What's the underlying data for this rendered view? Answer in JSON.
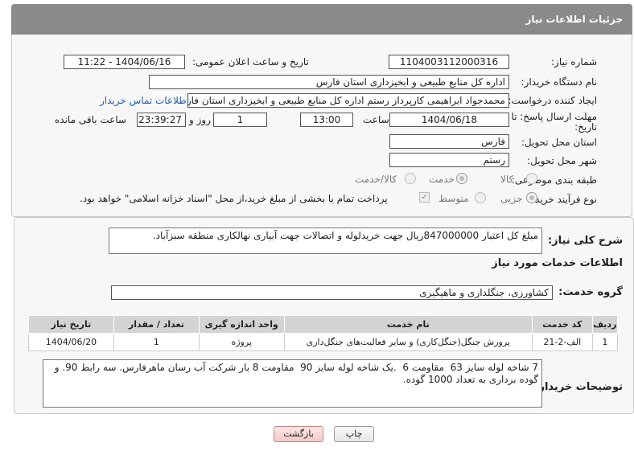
{
  "header": {
    "title": "جزئیات اطلاعات نیاز"
  },
  "fields": {
    "need_number_label": "شماره نیاز:",
    "need_number": "1104003112000316",
    "announce_label": "تاریخ و ساعت اعلان عمومی:",
    "announce_value": "1404/06/16 - 11:22",
    "buyer_org_label": "نام دستگاه خریدار:",
    "buyer_org": "اداره کل منابع طبیعی و ابخیزداری استان فارس",
    "requester_label": "ایجاد کننده درخواست:",
    "requester": "محمدجواد ابراهیمی کارپرداز رستم اداره کل منابع طبیعی و ابخیزداری استان فارس",
    "contact_link": "اطلاعات تماس خریدار",
    "deadline_label_1": "مهلت ارسال پاسخ: تا",
    "deadline_label_2": "تاریخ:",
    "deadline_date": "1404/06/18",
    "time_label": "ساعت",
    "deadline_time": "13:00",
    "days_value": "1",
    "days_label": "روز و",
    "remaining_time": "23:39:27",
    "remaining_label": "ساعت باقی مانده",
    "province_label": "استان محل تحویل:",
    "province": "فارس",
    "city_label": "شهر محل تحویل:",
    "city": "رستم",
    "category_label": "طبقه بندی موضوعی:",
    "category_options": [
      "کالا",
      "خدمت",
      "کالا/خدمت"
    ],
    "process_label": "نوع فرآیند خرید :",
    "process_options": [
      "جزیی",
      "متوسط"
    ],
    "payment_note": "پرداخت تمام یا بخشی از مبلغ خرید،از محل \"اسناد خزانه اسلامی\" خواهد بود."
  },
  "summary": {
    "label": "شرح کلی نیاز:",
    "text": "مبلغ کل اعتبار 847000000ریال جهت خریدلوله و اتصالات جهت آبیاری نهالکاری منطقه سبزآباد."
  },
  "services": {
    "section_title": "اطلاعات خدمات مورد نیاز",
    "group_label": "گروه خدمت:",
    "group_value": "کشاورزی، جنگلداری و ماهیگیری",
    "columns": [
      "ردیف",
      "کد خدمت",
      "نام خدمت",
      "واحد اندازه گیری",
      "تعداد / مقدار",
      "تاریخ نیاز"
    ],
    "rows": [
      [
        "1",
        "الف-2-21",
        "پرورش جنگل(جنگل‌کاری) و سایر فعالیت‌های جنگل‌داری",
        "پروژه",
        "1",
        "1404/06/20"
      ]
    ]
  },
  "buyer_notes": {
    "label": "توضیحات خریدار:",
    "text": "7 شاخه لوله سایز 63  مقاومت 6  .یک شاخه لوله سایز 90  مقاومت 8 بار شرکت آب رسان ماهرفارس. سه رابط 90. و گوده برداری به تعداد 1000 گوده."
  },
  "buttons": {
    "print": "چاپ",
    "back": "بازگشت"
  },
  "watermark": {
    "text": "AriaTender.net"
  },
  "colors": {
    "header_bg": "#8a8a8a",
    "link": "#1e5fb5",
    "watermark": "#c0392b",
    "back_button": "#f5c9c9"
  }
}
